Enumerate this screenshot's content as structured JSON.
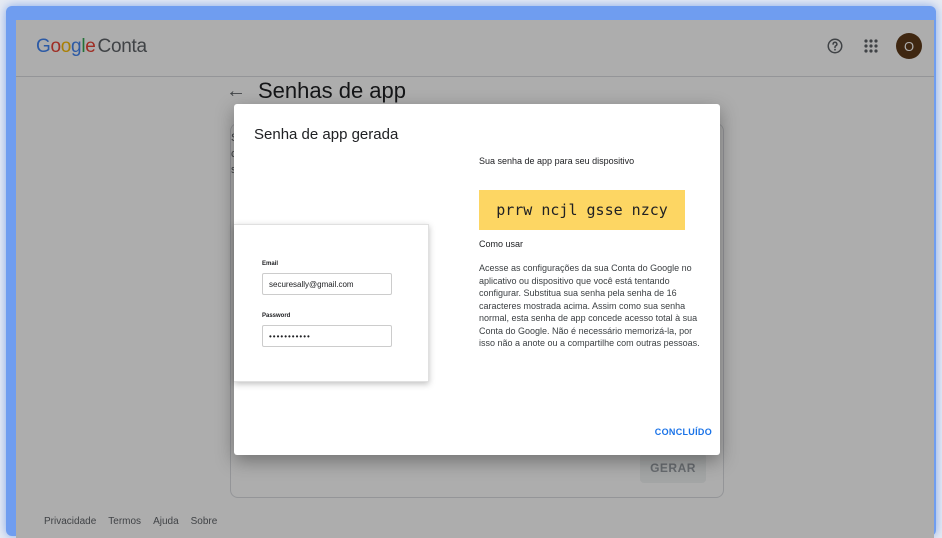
{
  "header": {
    "logo_google": "Google",
    "logo_product": "Conta",
    "avatar_letter": "O"
  },
  "page": {
    "title": "Senhas de app",
    "generate_button": "GERAR",
    "bg_snippet": [
      "S",
      "c",
      "s"
    ]
  },
  "dialog": {
    "title": "Senha de app gerada",
    "password_caption": "Sua senha de app para seu dispositivo",
    "password": "prrw ncjl gsse nzcy",
    "howto_title": "Como usar",
    "howto_text": "Acesse as configurações da sua Conta do Google no aplicativo ou dispositivo que você está tentando configurar. Substitua sua senha pela senha de 16 caracteres mostrada acima. Assim como sua senha normal, esta senha de app concede acesso total à sua Conta do Google. Não é necessário memorizá-la, por isso não a anote ou a compartilhe com outras pessoas.",
    "done_button": "CONCLUÍDO",
    "mock_login": {
      "email_label": "Email",
      "email_value": "securesally@gmail.com",
      "password_label": "Password",
      "password_dots": "•••••••••••"
    }
  },
  "footer": {
    "links": [
      "Privacidade",
      "Termos",
      "Ajuda",
      "Sobre"
    ]
  },
  "colors": {
    "password_highlight": "#fdd663",
    "accent": "#1a73e8"
  }
}
